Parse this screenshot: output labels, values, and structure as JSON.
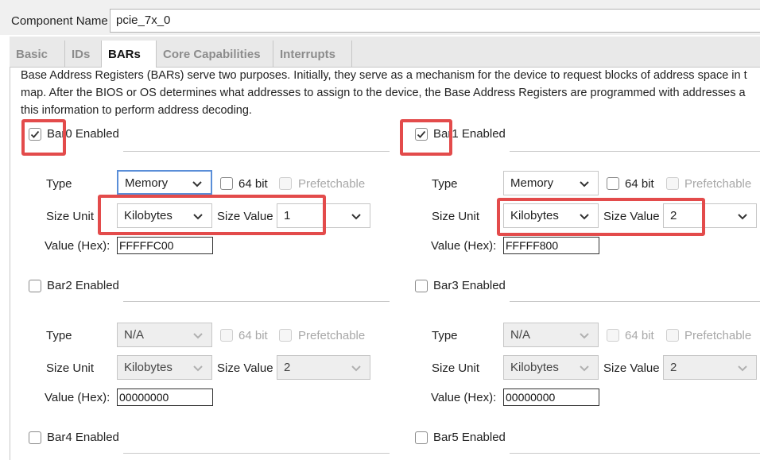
{
  "component": {
    "label": "Component Name",
    "value": "pcie_7x_0"
  },
  "tabs": [
    {
      "label": "Basic"
    },
    {
      "label": "IDs"
    },
    {
      "label": "BARs"
    },
    {
      "label": "Core Capabilities"
    },
    {
      "label": "Interrupts"
    }
  ],
  "active_tab": "BARs",
  "description": [
    "Base Address Registers (BARs) serve two purposes. Initially, they serve as a mechanism for the device to request blocks of address space in t",
    "map. After the BIOS or OS determines what addresses to assign to the device, the Base Address Registers are programmed with addresses a",
    "this information to perform address decoding."
  ],
  "field_labels": {
    "type": "Type",
    "size_unit": "Size Unit",
    "size_value": "Size Value",
    "value_hex": "Value (Hex):",
    "bit64": "64 bit",
    "prefetchable": "Prefetchable"
  },
  "bars": [
    {
      "label": "Bar0 Enabled",
      "enabled": true,
      "type": "Memory",
      "size_unit": "Kilobytes",
      "size_value": "1",
      "hex": "FFFFFC00"
    },
    {
      "label": "Bar1 Enabled",
      "enabled": true,
      "type": "Memory",
      "size_unit": "Kilobytes",
      "size_value": "2",
      "hex": "FFFFF800"
    },
    {
      "label": "Bar2 Enabled",
      "enabled": false,
      "type": "N/A",
      "size_unit": "Kilobytes",
      "size_value": "2",
      "hex": "00000000"
    },
    {
      "label": "Bar3 Enabled",
      "enabled": false,
      "type": "N/A",
      "size_unit": "Kilobytes",
      "size_value": "2",
      "hex": "00000000"
    },
    {
      "label": "Bar4 Enabled",
      "enabled": false
    },
    {
      "label": "Bar5 Enabled",
      "enabled": false
    }
  ],
  "colors": {
    "highlight": "#e34b4b",
    "focus": "#5a8ed8"
  }
}
